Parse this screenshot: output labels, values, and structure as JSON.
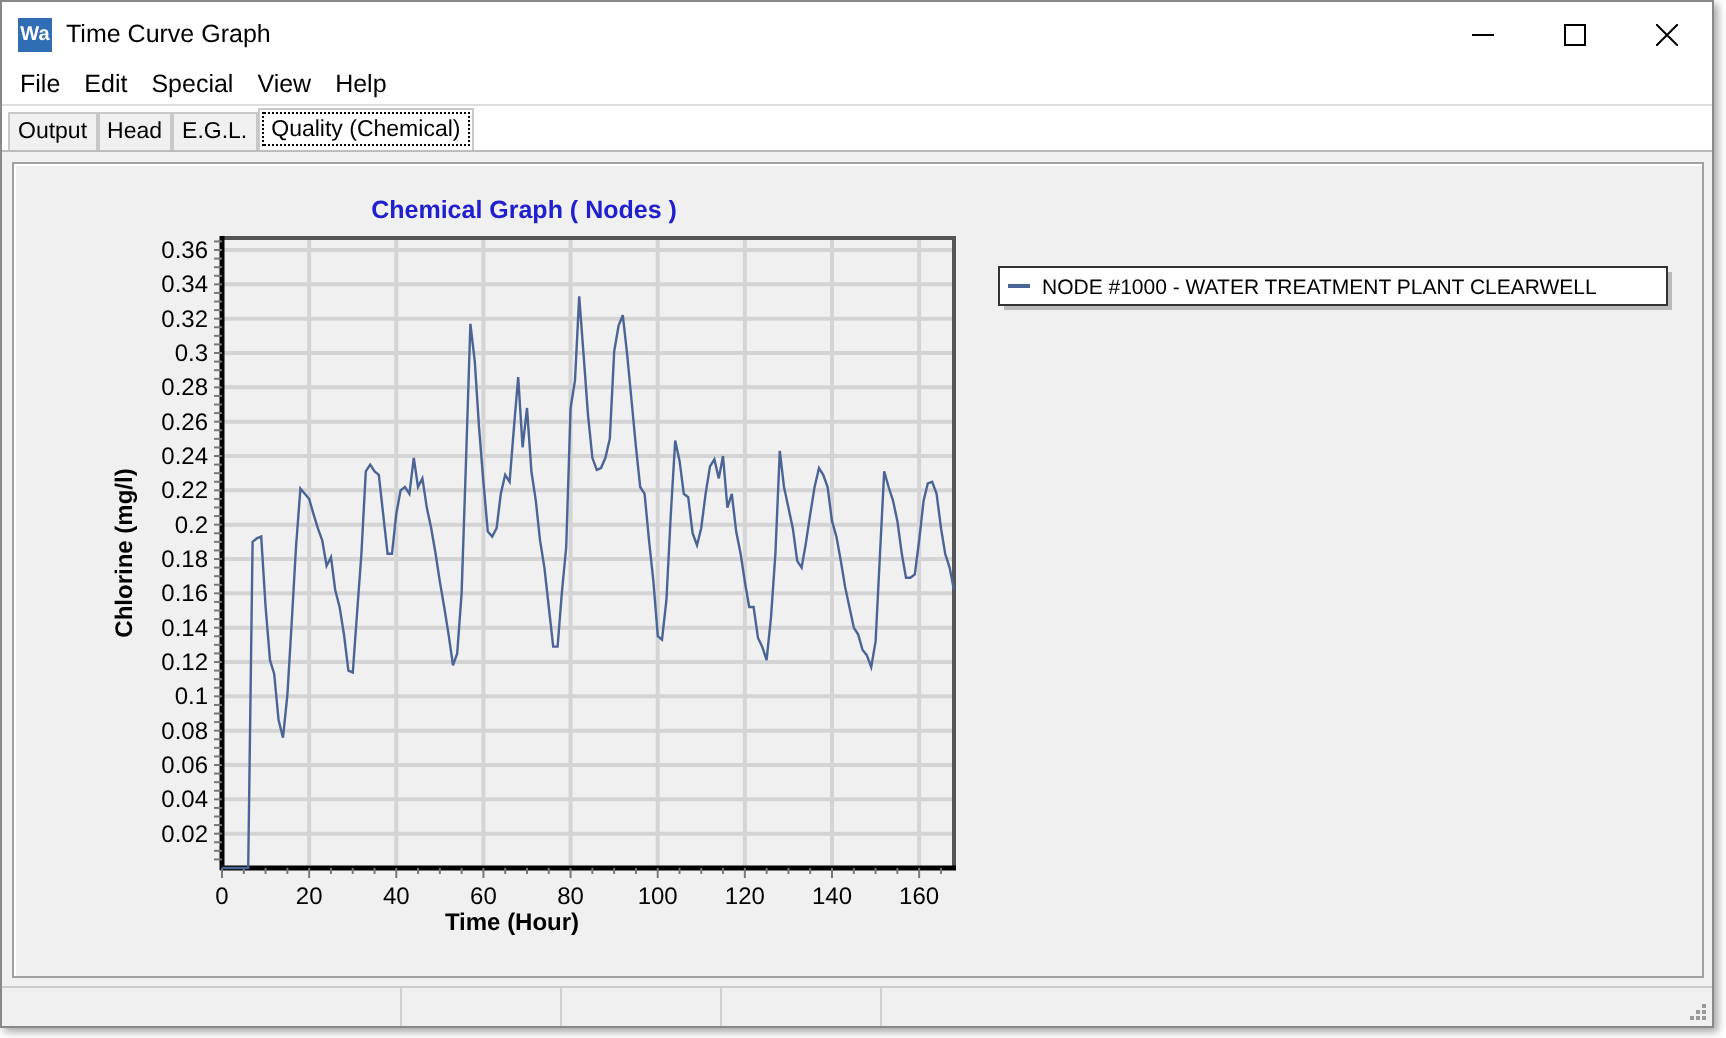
{
  "window": {
    "title": "Time Curve Graph",
    "app_icon": "Wa"
  },
  "menu": [
    "File",
    "Edit",
    "Special",
    "View",
    "Help"
  ],
  "tabs": [
    {
      "label": "Output",
      "selected": false
    },
    {
      "label": "Head",
      "selected": false
    },
    {
      "label": "E.G.L.",
      "selected": false
    },
    {
      "label": "Quality (Chemical)",
      "selected": true
    }
  ],
  "chart": {
    "chart_data": {
      "type": "line",
      "title": "Chemical Graph ( Nodes )",
      "xlabel": "Time (Hour)",
      "ylabel": "Chlorine (mg/l)",
      "x": [
        0,
        1,
        2,
        3,
        4,
        5,
        6,
        7,
        8,
        9,
        10,
        11,
        12,
        13,
        14,
        15,
        16,
        17,
        18,
        19,
        20,
        21,
        22,
        23,
        24,
        25,
        26,
        27,
        28,
        29,
        30,
        31,
        32,
        33,
        34,
        35,
        36,
        37,
        38,
        39,
        40,
        41,
        42,
        43,
        44,
        45,
        46,
        47,
        48,
        49,
        50,
        51,
        52,
        53,
        54,
        55,
        56,
        57,
        58,
        59,
        60,
        61,
        62,
        63,
        64,
        65,
        66,
        67,
        68,
        69,
        70,
        71,
        72,
        73,
        74,
        75,
        76,
        77,
        78,
        79,
        80,
        81,
        82,
        83,
        84,
        85,
        86,
        87,
        88,
        89,
        90,
        91,
        92,
        93,
        94,
        95,
        96,
        97,
        98,
        99,
        100,
        101,
        102,
        103,
        104,
        105,
        106,
        107,
        108,
        109,
        110,
        111,
        112,
        113,
        114,
        115,
        116,
        117,
        118,
        119,
        120,
        121,
        122,
        123,
        124,
        125,
        126,
        127,
        128,
        129,
        130,
        131,
        132,
        133,
        134,
        135,
        136,
        137,
        138,
        139,
        140,
        141,
        142,
        143,
        144,
        145,
        146,
        147,
        148,
        149,
        150,
        151,
        152,
        153,
        154,
        155,
        156,
        157,
        158,
        159,
        160,
        161,
        162,
        163,
        164,
        165,
        166,
        167,
        168
      ],
      "series": [
        {
          "name": "NODE #1000 - WATER TREATMENT PLANT CLEARWELL",
          "color": "#4a6496",
          "values": [
            0,
            0,
            0,
            0,
            0,
            0,
            0,
            0.19,
            0.192,
            0.193,
            0.152,
            0.121,
            0.113,
            0.086,
            0.076,
            0.101,
            0.144,
            0.187,
            0.221,
            0.218,
            0.215,
            0.206,
            0.198,
            0.191,
            0.176,
            0.181,
            0.162,
            0.152,
            0.136,
            0.115,
            0.114,
            0.148,
            0.183,
            0.231,
            0.235,
            0.231,
            0.229,
            0.206,
            0.183,
            0.183,
            0.206,
            0.22,
            0.222,
            0.218,
            0.239,
            0.222,
            0.227,
            0.21,
            0.198,
            0.183,
            0.167,
            0.152,
            0.136,
            0.118,
            0.125,
            0.16,
            0.237,
            0.317,
            0.295,
            0.257,
            0.225,
            0.196,
            0.193,
            0.198,
            0.218,
            0.229,
            0.225,
            0.257,
            0.286,
            0.245,
            0.268,
            0.231,
            0.214,
            0.191,
            0.175,
            0.152,
            0.129,
            0.129,
            0.16,
            0.187,
            0.268,
            0.284,
            0.333,
            0.299,
            0.264,
            0.239,
            0.232,
            0.233,
            0.239,
            0.25,
            0.301,
            0.316,
            0.322,
            0.299,
            0.272,
            0.245,
            0.222,
            0.218,
            0.191,
            0.167,
            0.135,
            0.133,
            0.156,
            0.206,
            0.249,
            0.237,
            0.218,
            0.216,
            0.195,
            0.188,
            0.198,
            0.218,
            0.234,
            0.238,
            0.227,
            0.24,
            0.21,
            0.218,
            0.196,
            0.183,
            0.167,
            0.152,
            0.152,
            0.134,
            0.129,
            0.121,
            0.146,
            0.183,
            0.243,
            0.222,
            0.21,
            0.198,
            0.179,
            0.175,
            0.189,
            0.206,
            0.222,
            0.233,
            0.229,
            0.222,
            0.202,
            0.193,
            0.179,
            0.164,
            0.152,
            0.14,
            0.136,
            0.127,
            0.124,
            0.117,
            0.132,
            0.183,
            0.231,
            0.222,
            0.214,
            0.202,
            0.183,
            0.169,
            0.169,
            0.171,
            0.191,
            0.214,
            0.224,
            0.225,
            0.218,
            0.198,
            0.183,
            0.175,
            0.162
          ]
        }
      ],
      "grid": true,
      "xlim": [
        0,
        168
      ],
      "ylim": [
        0,
        0.367
      ],
      "xticks": [
        0,
        20,
        40,
        60,
        80,
        100,
        120,
        140,
        160
      ],
      "yticks": [
        0.02,
        0.04,
        0.06,
        0.08,
        0.1,
        0.12,
        0.14,
        0.16,
        0.18,
        0.2,
        0.22,
        0.24,
        0.26,
        0.28,
        0.3,
        0.32,
        0.34,
        0.36
      ]
    }
  }
}
